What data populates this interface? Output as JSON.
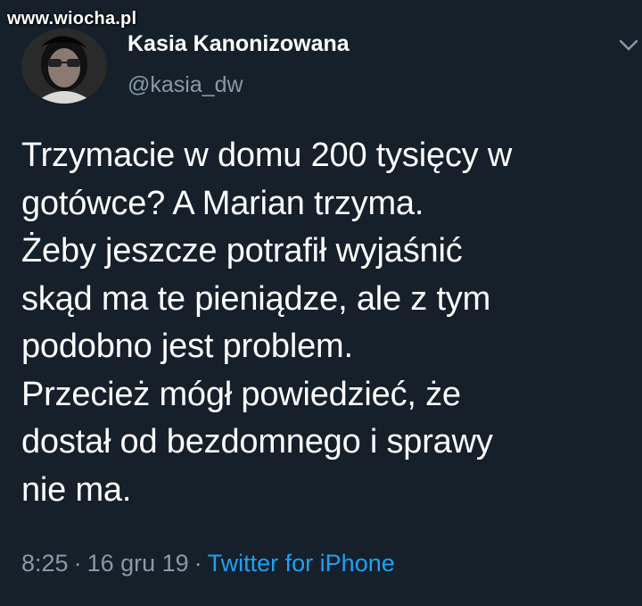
{
  "watermark": "www.wiocha.pl",
  "user": {
    "display_name": "Kasia Kanonizowana",
    "handle": "@kasia_dw"
  },
  "tweet": {
    "text": "Trzymacie w domu 200 tysięcy w\ngotówce? A Marian trzyma.\nŻeby jeszcze potrafił wyjaśnić\nskąd ma te pieniądze, ale z tym\npodobno jest problem.\nPrzecież mógł powiedzieć, że\ndostał od bezdomnego i sprawy\nnie ma.",
    "time": "8:25",
    "date": "16 gru 19",
    "separator": "·",
    "source": "Twitter for iPhone"
  },
  "icons": {
    "more": "chevron-down-icon",
    "avatar": "avatar"
  },
  "colors": {
    "background": "#15202b",
    "secondary_text": "#8899a6",
    "link": "#1da1f2"
  }
}
